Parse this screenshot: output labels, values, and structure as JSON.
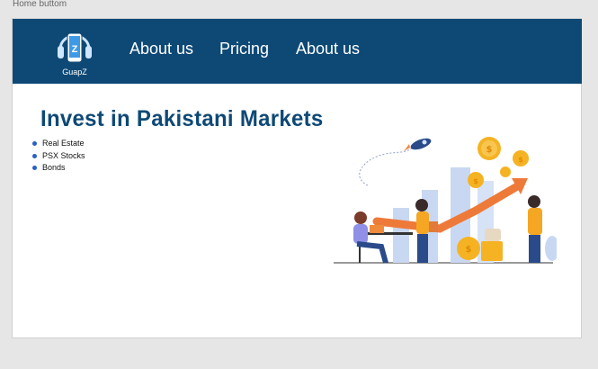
{
  "frame": {
    "label": "Home buttom"
  },
  "brand": {
    "name": "GuapZ",
    "logo_icon": "headphones-phone-icon"
  },
  "nav": {
    "items": [
      {
        "label": "About us"
      },
      {
        "label": "Pricing"
      },
      {
        "label": "About us"
      }
    ]
  },
  "hero": {
    "title": "Invest in Pakistani Markets",
    "bullets": [
      "Real Estate",
      "PSX Stocks",
      "Bonds"
    ],
    "illustration_icon": "investment-growth-illustration"
  },
  "colors": {
    "navbar": "#0e4976",
    "title": "#0e4976",
    "bullet": "#2b5fc4",
    "canvas": "#e6e6e6"
  }
}
